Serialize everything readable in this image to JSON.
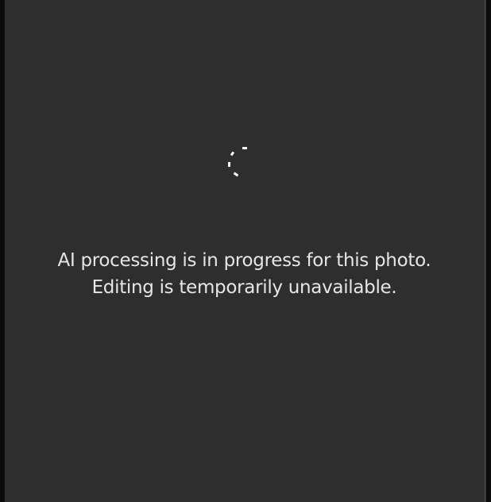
{
  "status": {
    "line1": "AI processing is in progress for this photo.",
    "line2": "Editing is temporarily unavailable.",
    "spinner_icon": "loading-spinner-icon"
  },
  "colors": {
    "panel_background": "#2e2e2e",
    "frame_background": "#0c0c0c",
    "text": "#e6e6e6",
    "spinner": "#ffffff"
  }
}
